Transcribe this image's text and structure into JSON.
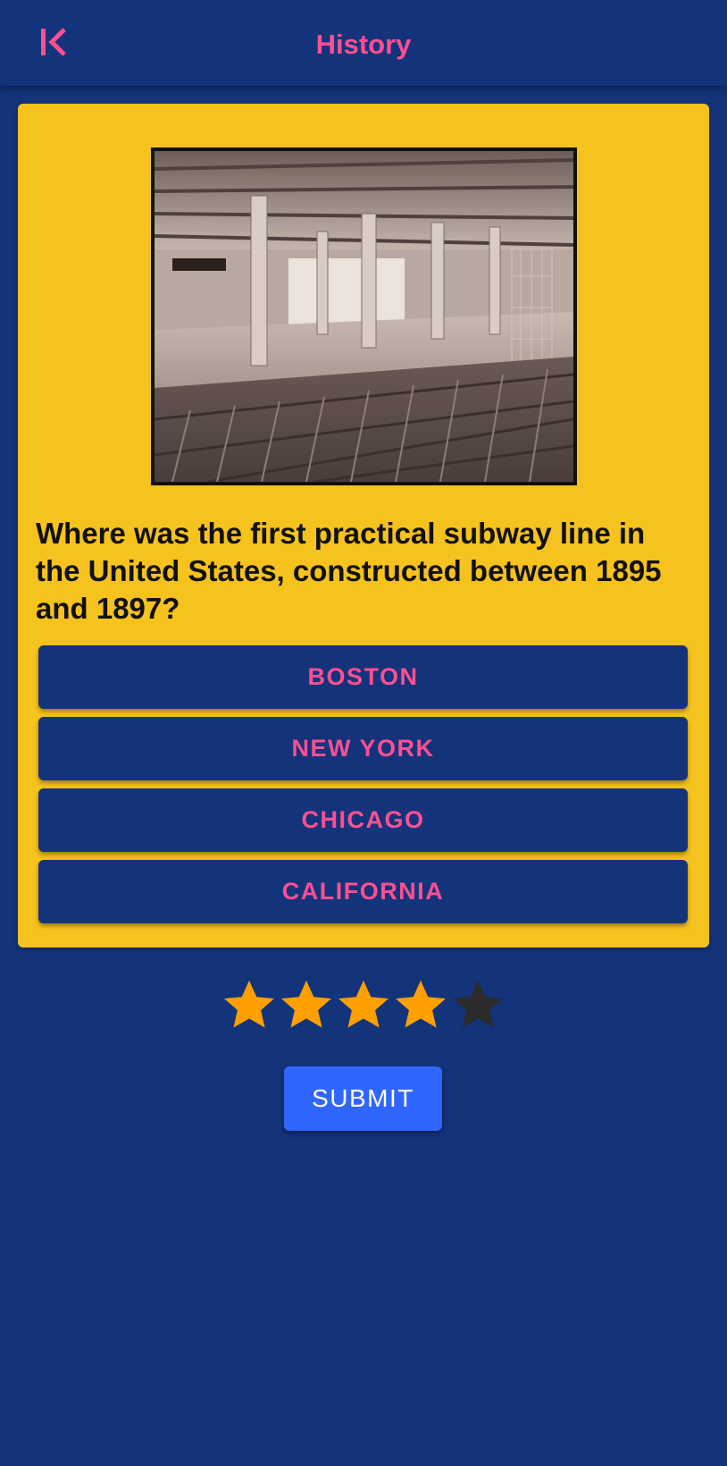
{
  "header": {
    "title": "History",
    "back_icon": "first-page-icon",
    "accent_color": "#ff4f93"
  },
  "question_card": {
    "background_color": "#f6c21e",
    "image_icon": "subway-station-photo",
    "question": "Where was the first practical subway line in the United States, constructed between 1895 and 1897?",
    "answers": [
      {
        "label": "BOSTON"
      },
      {
        "label": "NEW YORK"
      },
      {
        "label": "CHICAGO"
      },
      {
        "label": "CALIFORNIA"
      }
    ]
  },
  "rating": {
    "value": 4,
    "max": 5,
    "filled_color": "#ffa000",
    "empty_color": "#2b2b2b"
  },
  "submit": {
    "label": "SUBMIT",
    "color": "#2f66ff"
  },
  "theme": {
    "background": "#13337a"
  }
}
